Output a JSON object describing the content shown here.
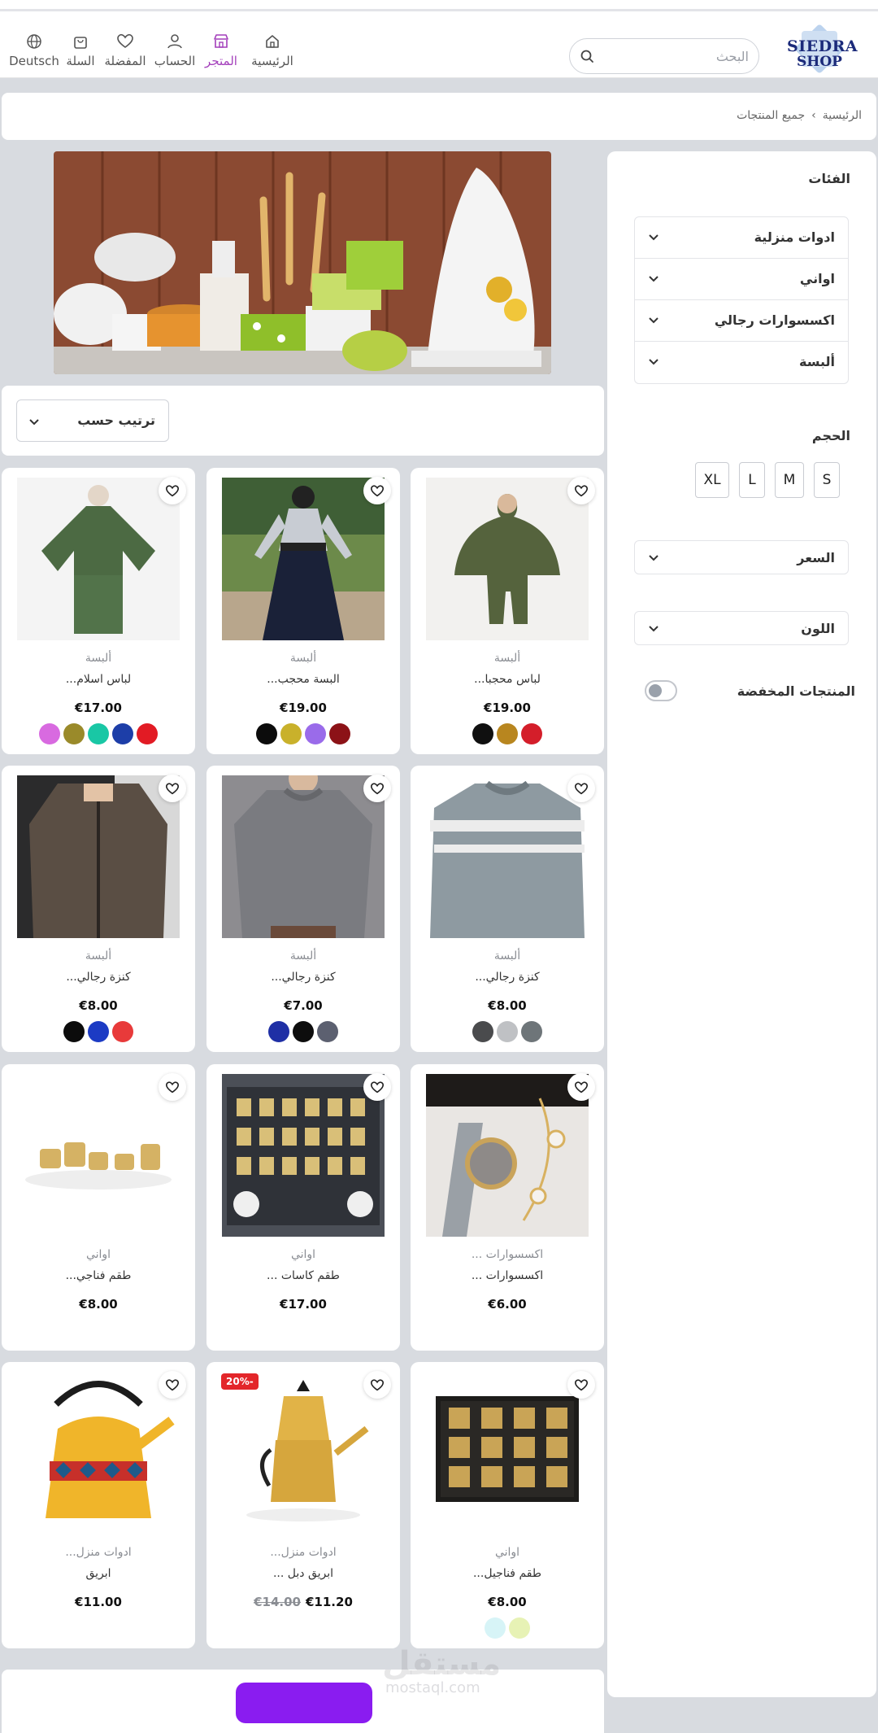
{
  "header": {
    "logo_line1": "SIEDRA",
    "logo_line2": "SHOP",
    "search_placeholder": "البحث",
    "nav": [
      {
        "label": "الرئيسية",
        "icon": "home-icon"
      },
      {
        "label": "المتجر",
        "icon": "store-icon",
        "active": true
      },
      {
        "label": "الحساب",
        "icon": "user-icon"
      },
      {
        "label": "المفضلة",
        "icon": "heart-icon"
      },
      {
        "label": "السلة",
        "icon": "bag-icon"
      },
      {
        "label": "Deutsch",
        "icon": "globe-icon"
      }
    ]
  },
  "breadcrumb": {
    "home": "الرئيسية",
    "separator": "›",
    "current": "جميع المنتجات"
  },
  "sidebar": {
    "categories_title": "الفئات",
    "categories": [
      "ادوات منزلية",
      "اواني",
      "اكسسوارات رجالي",
      "ألبسة"
    ],
    "size_title": "الحجم",
    "sizes": [
      "XL",
      "L",
      "M",
      "S"
    ],
    "price_label": "السعر",
    "color_label": "اللون",
    "sale_label": "المنتجات المخفضة"
  },
  "sort": {
    "label": "ترتيب حسب"
  },
  "products": [
    {
      "category": "ألبسة",
      "name": "لباس محجبا...",
      "price": "€19.00",
      "colors": [
        "#101010",
        "#b8861f",
        "#d41e2a"
      ],
      "img": "olive-outfit"
    },
    {
      "category": "ألبسة",
      "name": "البسة محجب...",
      "price": "€19.00",
      "colors": [
        "#0c0c0c",
        "#c9b12b",
        "#9a6bea",
        "#8c1217"
      ],
      "img": "navy-dress"
    },
    {
      "category": "ألبسة",
      "name": "لباس اسلام...",
      "price": "€17.00",
      "colors": [
        "#d86ae0",
        "#9a8a2a",
        "#19c7a5",
        "#1d3ea8",
        "#e21b24"
      ],
      "img": "green-outfit"
    },
    {
      "category": "ألبسة",
      "name": "كنزة رجالي...",
      "price": "€8.00",
      "colors": [
        "#4a4b4d",
        "#bfc1c4",
        "#6e7579"
      ],
      "img": "striped-sweater"
    },
    {
      "category": "ألبسة",
      "name": "كنزة رجالي...",
      "price": "€7.00",
      "colors": [
        "#1f2fa5",
        "#0d0d0d",
        "#5c6070"
      ],
      "img": "grey-sweater"
    },
    {
      "category": "ألبسة",
      "name": "كنزة رجالي...",
      "price": "€8.00",
      "colors": [
        "#0c0c0c",
        "#1c3bc4",
        "#e83a3a"
      ],
      "img": "brown-cardigan"
    },
    {
      "category": "اكسسوارات ...",
      "name": "اكسسوارات ...",
      "price": "€6.00",
      "colors": [],
      "img": "watch-set"
    },
    {
      "category": "اواني",
      "name": "طقم كاسات ...",
      "price": "€17.00",
      "colors": [],
      "img": "glasses-set"
    },
    {
      "category": "اواني",
      "name": "طقم فناجي...",
      "price": "€8.00",
      "colors": [],
      "img": "cups-set"
    },
    {
      "category": "اواني",
      "name": "طقم فناجيل...",
      "price": "€8.00",
      "colors": [
        "#d7f4f7",
        "#e7f2b5"
      ],
      "img": "gold-cups"
    },
    {
      "category": "ادوات منزل...",
      "name": "ابريق دبل ...",
      "price": "€11.20",
      "old_price": "€14.00",
      "badge": "20%-",
      "colors": [],
      "img": "gold-teapot"
    },
    {
      "category": "ادوات منزل...",
      "name": "ابريق",
      "price": "€11.00",
      "colors": [],
      "img": "yellow-kettle"
    }
  ],
  "watermark": {
    "line1": "مستقل",
    "line2": "mostaql.com"
  }
}
